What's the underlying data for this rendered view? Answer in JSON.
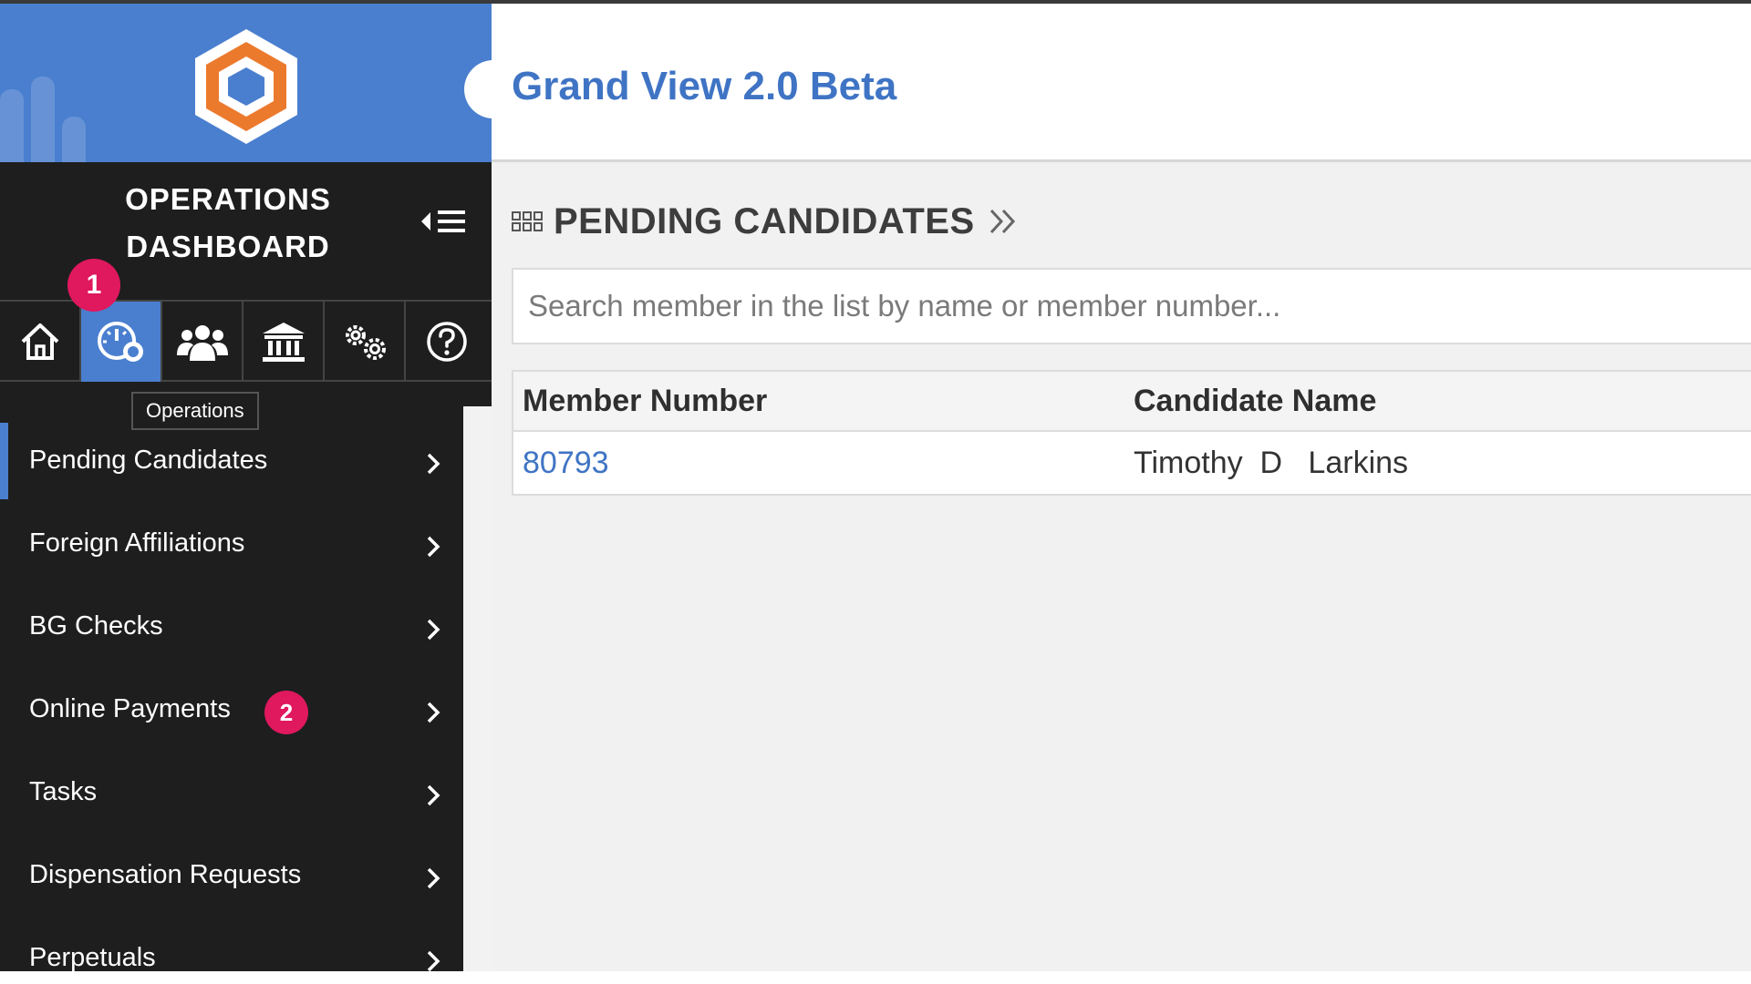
{
  "sidebar": {
    "title_line1": "OPERATIONS",
    "title_line2": "DASHBOARD",
    "nav_icons": [
      {
        "name": "home-icon",
        "active": false
      },
      {
        "name": "operations-dashboard-icon",
        "active": true
      },
      {
        "name": "members-icon",
        "active": false
      },
      {
        "name": "lodge-building-icon",
        "active": false
      },
      {
        "name": "settings-gears-icon",
        "active": false
      },
      {
        "name": "help-icon",
        "active": false
      }
    ],
    "tooltip": "Operations",
    "menu": [
      {
        "label": "Pending Candidates",
        "active": true
      },
      {
        "label": "Foreign Affiliations"
      },
      {
        "label": "BG Checks"
      },
      {
        "label": "Online Payments"
      },
      {
        "label": "Tasks"
      },
      {
        "label": "Dispensation Requests"
      },
      {
        "label": "Perpetuals"
      }
    ]
  },
  "annotations": {
    "badge1": "1",
    "badge2": "2"
  },
  "header": {
    "app_title": "Grand View 2.0 Beta"
  },
  "main": {
    "page_title": "PENDING CANDIDATES",
    "search_placeholder": "Search member in the list by name or member number...",
    "table": {
      "columns": [
        "Member Number",
        "Candidate Name"
      ],
      "rows": [
        {
          "member_number": "80793",
          "candidate_name": "Timothy  D   Larkins"
        }
      ]
    }
  },
  "colors": {
    "accent": "#4a7fcf",
    "sidebar_bg": "#1e1e1e",
    "badge": "#e0185e",
    "logo_orange": "#ec7a2d",
    "title_blue": "#3f74c4"
  }
}
